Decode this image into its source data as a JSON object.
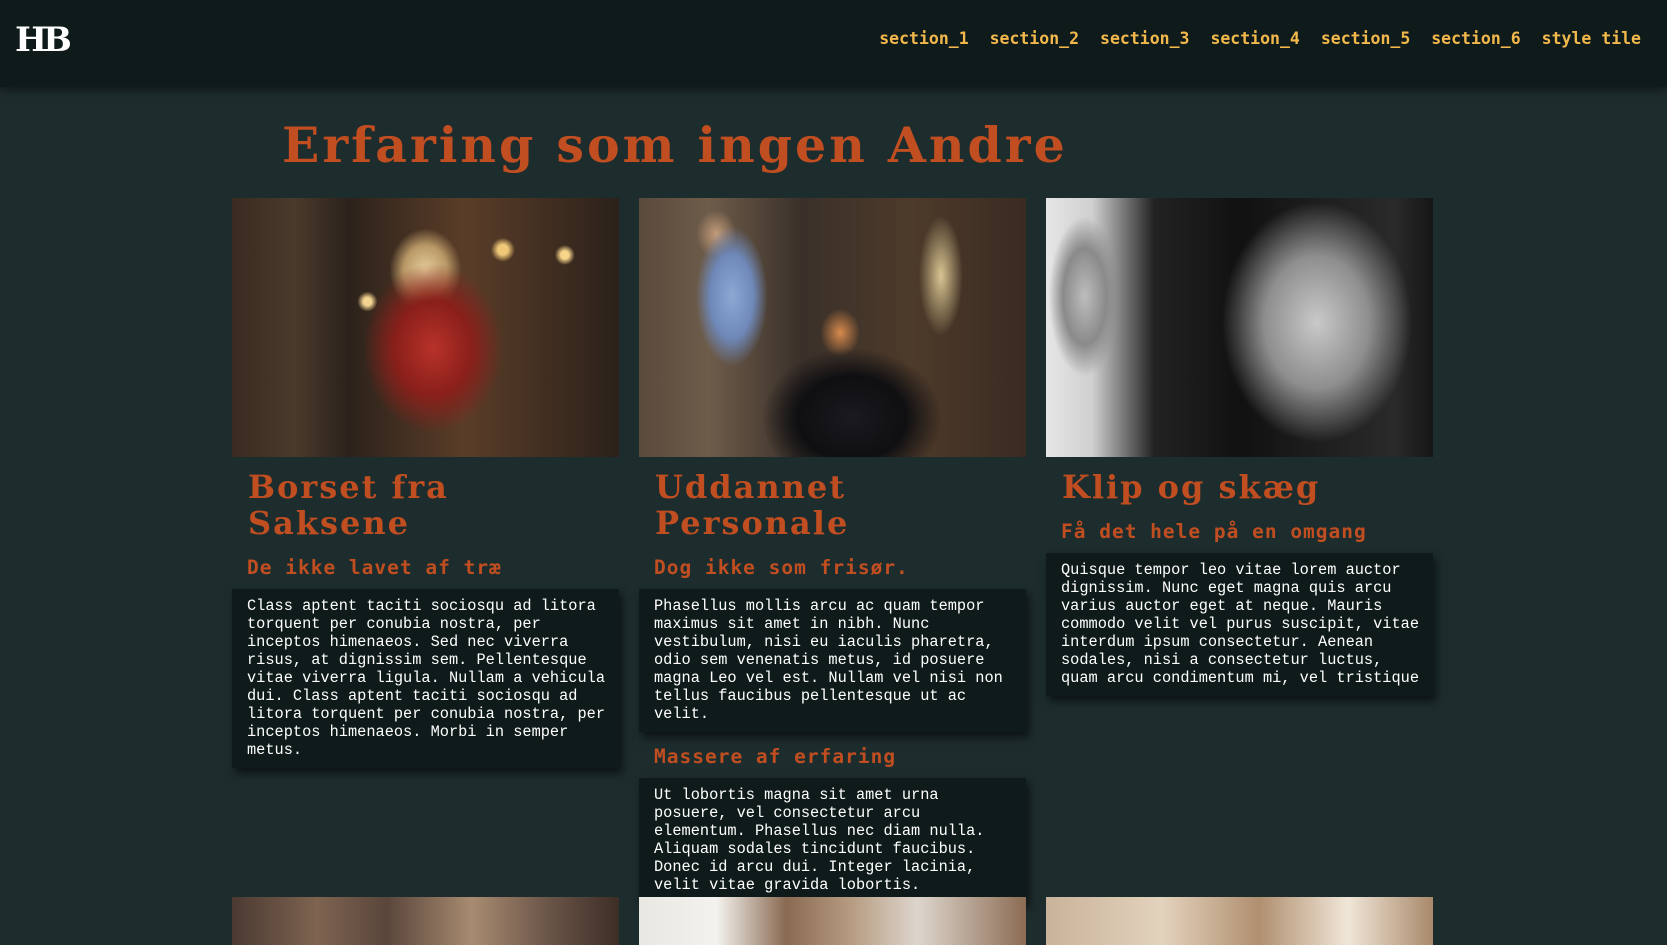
{
  "header": {
    "logo": "HB",
    "nav": [
      "section_1",
      "section_2",
      "section_3",
      "section_4",
      "section_5",
      "section_6",
      "style tile"
    ]
  },
  "main": {
    "title": "Erfaring som ingen Andre",
    "cards": [
      {
        "title": "Borset fra Saksene",
        "subtitle": "De ikke lavet af træ",
        "body": "Class aptent taciti sociosqu ad litora torquent per conubia nostra, per inceptos himenaeos. Sed nec viverra risus, at dignissim sem. Pellentesque vitae viverra ligula. Nullam a vehicula dui. Class aptent taciti sociosqu ad litora torquent per conubia nostra, per inceptos himenaeos. Morbi in semper metus."
      },
      {
        "title": "Uddannet Personale",
        "subtitle": "Dog ikke som frisør.",
        "body": "Phasellus mollis arcu ac quam tempor maximus sit amet in nibh. Nunc vestibulum, nisi eu iaculis pharetra, odio sem venenatis metus, id posuere magna Leo vel est. Nullam vel nisi non tellus faucibus pellentesque ut ac velit.",
        "subtitle2": "Massere af erfaring",
        "body2": "Ut lobortis magna sit amet urna posuere, vel consectetur arcu elementum. Phasellus nec diam nulla. Aliquam sodales tincidunt faucibus. Donec id arcu dui. Integer lacinia, velit vitae gravida lobortis."
      },
      {
        "title": "Klip og skæg",
        "subtitle": "Få det hele på en omgang",
        "body": "Quisque tempor leo vitae lorem auctor dignissim. Nunc eget magna quis arcu varius auctor eget at neque. Mauris commodo velit vel purus suscipit, vitae interdum ipsum consectetur. Aenean sodales, nisi a consectetur luctus, quam arcu condimentum mi, vel tristique"
      }
    ]
  },
  "colors": {
    "background": "#1d2c2d",
    "header": "#0f1a1b",
    "nav": "#f2b84b",
    "accent": "#c04e21",
    "text": "#ffffff"
  }
}
